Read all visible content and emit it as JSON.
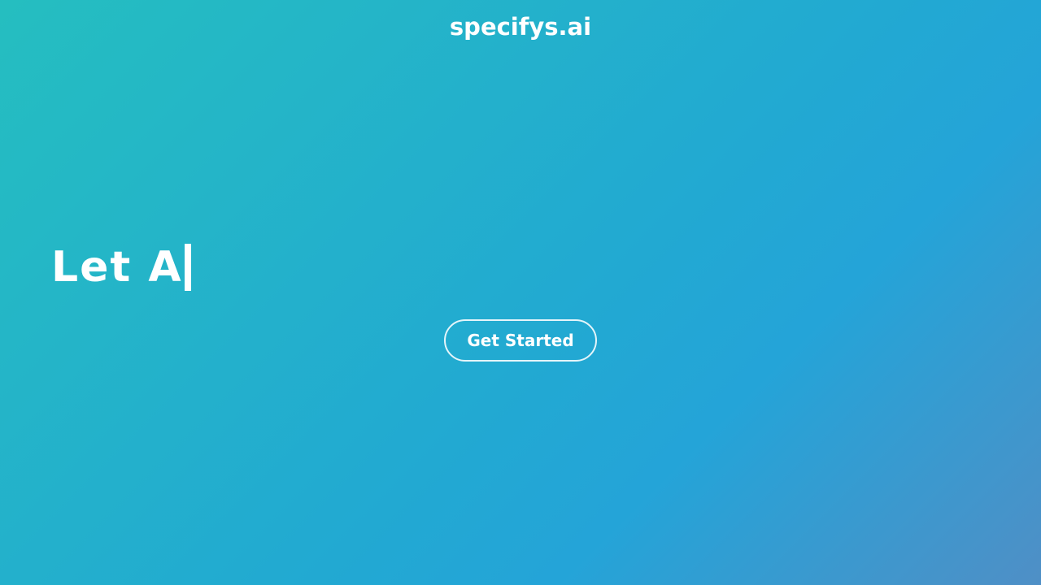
{
  "header": {
    "brand": "specifys.ai"
  },
  "hero": {
    "typed_text": "Let A"
  },
  "cta": {
    "label": "Get Started"
  },
  "colors": {
    "gradient_start": "#25bec0",
    "gradient_mid": "#22a9d2",
    "gradient_end": "#4f8fc6",
    "text": "#ffffff"
  }
}
